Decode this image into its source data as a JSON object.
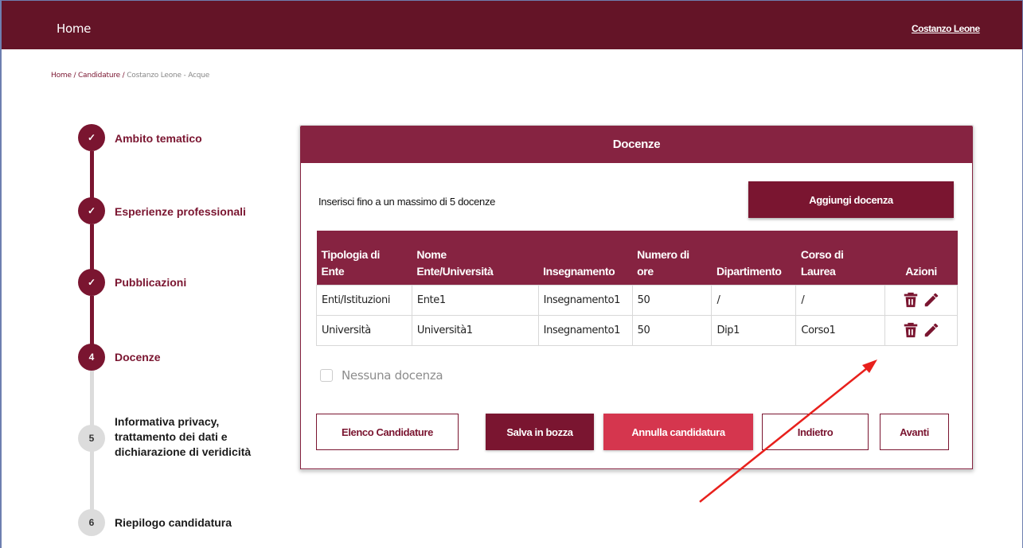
{
  "topbar": {
    "home_label": "Home",
    "user_name": "Costanzo Leone"
  },
  "breadcrumb": {
    "home": "Home",
    "sep": "/",
    "candidature": "Candidature",
    "current": "Costanzo Leone - Acque"
  },
  "steps": [
    {
      "marker": "✓",
      "label": "Ambito tematico",
      "state": "done"
    },
    {
      "marker": "✓",
      "label": "Esperienze professionali",
      "state": "done"
    },
    {
      "marker": "✓",
      "label": "Pubblicazioni",
      "state": "done"
    },
    {
      "marker": "4",
      "label": "Docenze",
      "state": "active"
    },
    {
      "marker": "5",
      "label_lines": [
        "Informativa privacy,",
        "trattamento dei dati e",
        "dichiarazione di veridicità"
      ],
      "state": "todo"
    },
    {
      "marker": "6",
      "label": "Riepilogo candidatura",
      "state": "todo"
    }
  ],
  "card": {
    "title": "Docenze",
    "intro": "Inserisci fino a un massimo di 5 docenze",
    "add_button": "Aggiungi docenza",
    "table": {
      "headers": [
        [
          "Tipologia di",
          "Ente"
        ],
        [
          "Nome",
          "Ente/Università"
        ],
        [
          "",
          "Insegnamento"
        ],
        [
          "Numero di",
          "ore"
        ],
        [
          "",
          "Dipartimento"
        ],
        [
          "Corso di",
          "Laurea"
        ],
        [
          "",
          "Azioni"
        ]
      ],
      "rows": [
        [
          "Enti/Istituzioni",
          "Ente1",
          "Insegnamento1",
          "50",
          "/",
          "/"
        ],
        [
          "Università",
          "Università1",
          "Insegnamento1",
          "50",
          "Dip1",
          "Corso1"
        ]
      ]
    },
    "checkbox_label": "Nessuna docenza",
    "buttons": {
      "elenco": "Elenco Candidature",
      "salva": "Salva in bozza",
      "annulla": "Annulla candidatura",
      "indietro": "Indietro",
      "avanti": "Avanti"
    }
  },
  "colors": {
    "brand": "#641427",
    "primary": "#7a1530",
    "header": "#862341",
    "danger": "#d5364e",
    "annotation": "#e8201c"
  },
  "icons": {
    "delete": "trash-icon",
    "edit": "pencil-icon",
    "done": "check-icon"
  }
}
